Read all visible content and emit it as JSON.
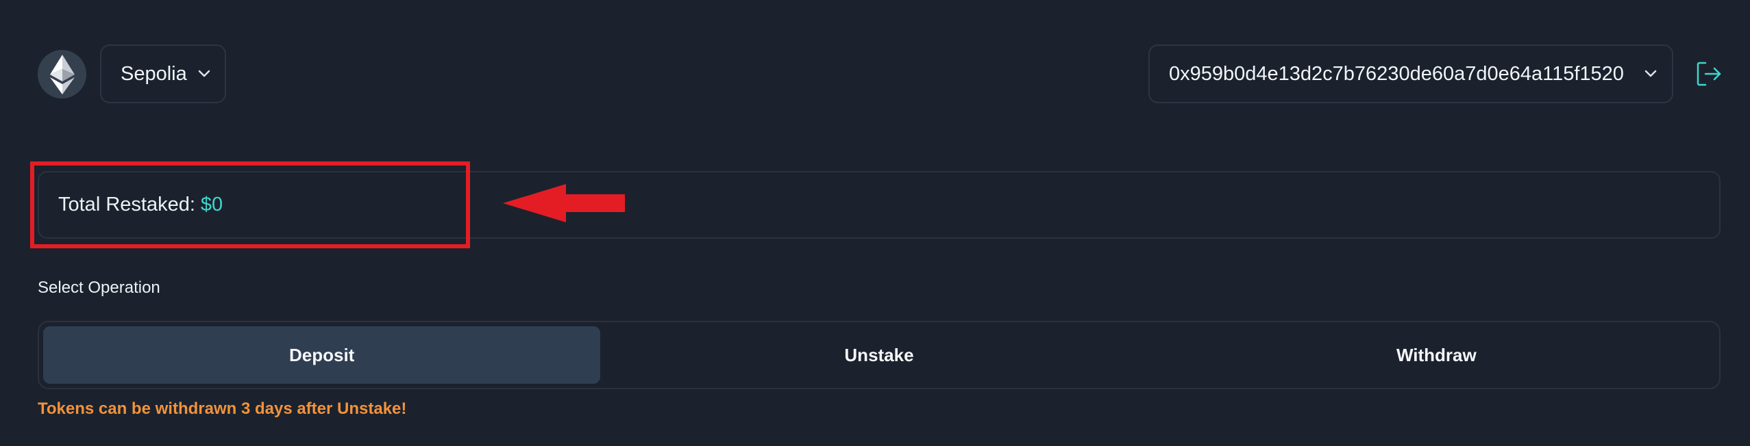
{
  "header": {
    "network_icon": "ethereum-icon",
    "network": "Sepolia",
    "wallet_address": "0x959b0d4e13d2c7b76230de60a7d0e64a115f1520",
    "logout_icon": "logout-icon"
  },
  "summary": {
    "total_label": "Total Restaked:",
    "total_value": "$0"
  },
  "annotation": {
    "highlight_color": "#e41d24",
    "arrow_icon": "left-arrow-icon"
  },
  "operation": {
    "label": "Select Operation",
    "tabs": [
      {
        "label": "Deposit",
        "active": true
      },
      {
        "label": "Unstake",
        "active": false
      },
      {
        "label": "Withdraw",
        "active": false
      }
    ],
    "warning": "Tokens can be withdrawn 3 days after Unstake!"
  },
  "colors": {
    "background": "#1b222d",
    "accent": "#3fd6cf",
    "warning": "#f2923b",
    "active_tab": "#2f3e51"
  }
}
